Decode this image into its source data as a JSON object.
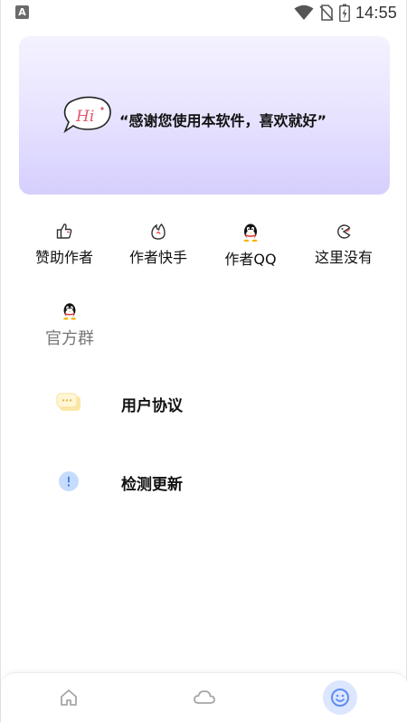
{
  "status_bar": {
    "notification_letter": "A",
    "time": "14:55"
  },
  "banner": {
    "bubble_text": "Hi",
    "quote": "“感谢您使用本软件，喜欢就好”"
  },
  "grid": {
    "items": [
      {
        "label": "赞助作者",
        "icon": "thumbs-up-icon"
      },
      {
        "label": "作者快手",
        "icon": "kuaishou-icon"
      },
      {
        "label": "作者QQ",
        "icon": "qq-penguin-icon"
      },
      {
        "label": "这里没有",
        "icon": "pacman-icon"
      },
      {
        "label": "官方群",
        "icon": "qq-penguin-icon"
      }
    ]
  },
  "list": {
    "items": [
      {
        "label": "用户协议",
        "icon": "chat-bubble-icon"
      },
      {
        "label": "检测更新",
        "icon": "info-circle-icon"
      }
    ]
  },
  "bottom_nav": {
    "items": [
      {
        "icon": "home-icon",
        "active": false
      },
      {
        "icon": "cloud-icon",
        "active": false
      },
      {
        "icon": "smiley-icon",
        "active": true
      }
    ],
    "active_color": "#5b8cf5"
  }
}
